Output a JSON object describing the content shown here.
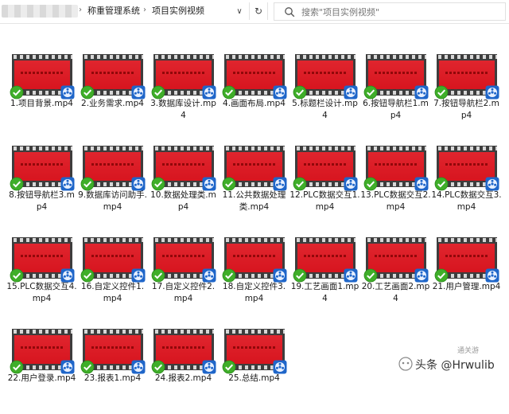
{
  "address_bar": {
    "breadcrumbs": [
      "称重管理系统",
      "项目实例视频"
    ],
    "refresh_glyph": "↻",
    "dropdown_glyph": "∨"
  },
  "search": {
    "placeholder": "搜索\"项目实例视频\""
  },
  "files": [
    "1.项目背景.mp4",
    "2.业务需求.mp4",
    "3.数据库设计.mp4",
    "4.画面布局.mp4",
    "5.标题栏设计.mp4",
    "6.按钮导航栏1.mp4",
    "7.按钮导航栏2.mp4",
    "8.按钮导航栏3.mp4",
    "9.数据库访问助手.mp4",
    "10.数据处理类.mp4",
    "11.公共数据处理类.mp4",
    "12.PLC数据交互1.mp4",
    "13.PLC数据交互2.mp4",
    "14.PLC数据交互3.mp4",
    "15.PLC数据交互4.mp4",
    "16.自定义控件1.mp4",
    "17.自定义控件2.mp4",
    "18.自定义控件3.mp4",
    "19.工艺画面1.mp4",
    "20.工艺画面2.mp4",
    "21.用户管理.mp4",
    "22.用户登录.mp4",
    "23.报表1.mp4",
    "24.报表2.mp4",
    "25.总结.mp4"
  ],
  "watermark": {
    "text": "头条 @Hrwulib",
    "sub": "通关游"
  },
  "colors": {
    "thumb_red": "#d7151f",
    "check_green": "#3fae29",
    "reel_blue": "#1f66c9"
  },
  "icons": {
    "search": "search-icon",
    "check": "check-icon",
    "reel": "reel-icon"
  }
}
